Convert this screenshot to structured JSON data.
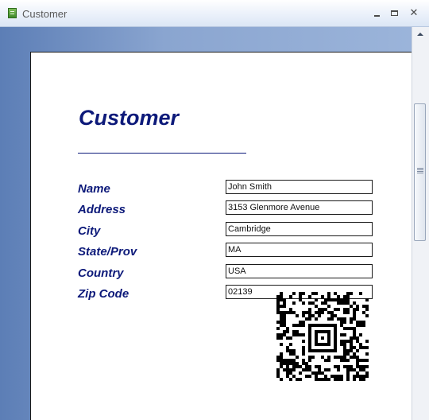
{
  "window": {
    "title": "Customer",
    "icon": "form-icon"
  },
  "report": {
    "title": "Customer",
    "fields": [
      {
        "label": "Name",
        "value": "John Smith"
      },
      {
        "label": "Address",
        "value": "3153 Glenmore Avenue"
      },
      {
        "label": "City",
        "value": "Cambridge"
      },
      {
        "label": "State/Prov",
        "value": "MA"
      },
      {
        "label": "Country",
        "value": "USA"
      },
      {
        "label": "Zip Code",
        "value": "02139"
      }
    ]
  },
  "colors": {
    "label_color": "#0d1a7a",
    "window_frame": "#6f8fc0"
  },
  "icons": {
    "minimize": "minimize-icon",
    "maximize": "maximize-icon",
    "close": "close-icon",
    "barcode": "2d-barcode-icon"
  }
}
